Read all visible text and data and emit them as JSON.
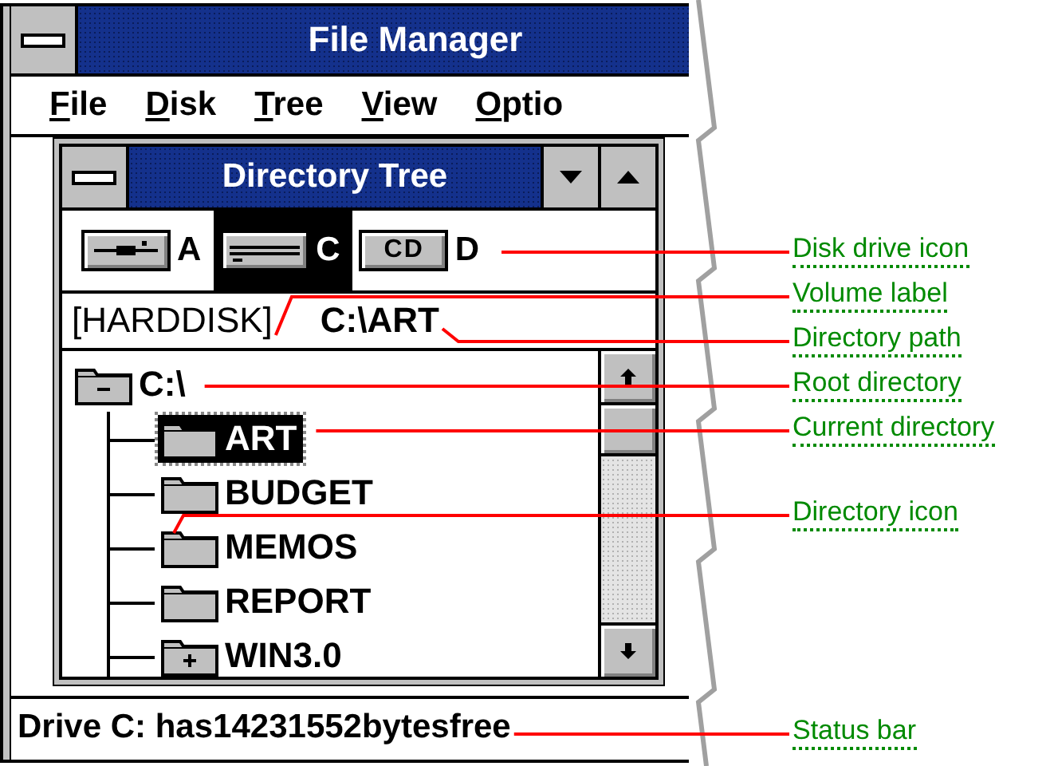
{
  "window": {
    "title": "File Manager"
  },
  "menu": [
    {
      "label": "File"
    },
    {
      "label": "Disk"
    },
    {
      "label": "Tree"
    },
    {
      "label": "View"
    },
    {
      "label": "Optio"
    }
  ],
  "child_window": {
    "title": "Directory Tree",
    "drives": [
      {
        "letter": "A",
        "kind": "floppy",
        "selected": false
      },
      {
        "letter": "C",
        "kind": "hard",
        "selected": true
      },
      {
        "letter": "D",
        "kind": "cd",
        "icon_label": "CD",
        "selected": false
      }
    ],
    "volume_label": "[HARDDISK]",
    "path": "C:\\ART",
    "tree": {
      "label": "C:\\",
      "expandable": true,
      "expanded": true,
      "selected": false,
      "children": [
        {
          "label": "ART",
          "expandable": false,
          "selected": true
        },
        {
          "label": "BUDGET",
          "expandable": false,
          "selected": false
        },
        {
          "label": "MEMOS",
          "expandable": false,
          "selected": false
        },
        {
          "label": "REPORT",
          "expandable": false,
          "selected": false
        },
        {
          "label": "WIN3.0",
          "expandable": true,
          "expanded": false,
          "selected": false
        }
      ]
    }
  },
  "status_bar": "Drive C: has14231552bytesfree",
  "callouts": [
    "Disk drive icon",
    "Volume label",
    "Directory path",
    "Root directory",
    "Current directory",
    "Directory icon",
    "Status bar"
  ]
}
